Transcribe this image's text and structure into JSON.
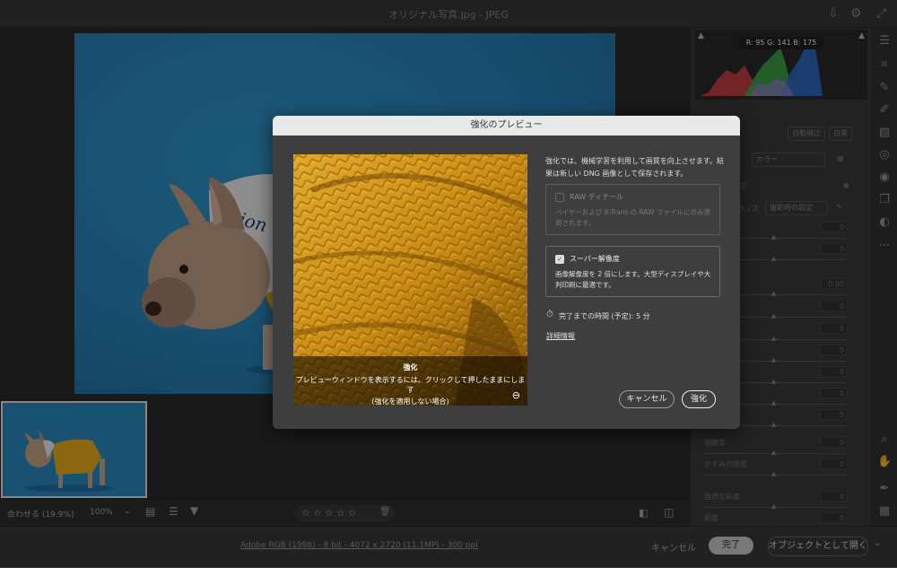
{
  "window": {
    "title": "オリジナル写真.jpg  -  JPEG"
  },
  "histogram": {
    "r_label": "R: 95",
    "g_label": "G: 141",
    "b_label": "B: 175"
  },
  "right_panel": {
    "auto_button": "自動補正",
    "bw_button": "白黒",
    "profile_value": "カラー",
    "wb_label": "ランス",
    "wb_value": "撮影時の設定",
    "section_label": "正",
    "sliders": [
      {
        "label": "",
        "value": "0"
      },
      {
        "label": "光",
        "value": "0"
      },
      {
        "label": "",
        "value": "0.00"
      },
      {
        "label": "スト",
        "value": "0"
      },
      {
        "label": "",
        "value": "0"
      },
      {
        "label": "",
        "value": "0"
      },
      {
        "label": "",
        "value": "0"
      },
      {
        "label": "",
        "value": "0"
      },
      {
        "label": "",
        "value": "0"
      },
      {
        "label": "明瞭度",
        "value": "0"
      },
      {
        "label": "かすみの除去",
        "value": "0"
      },
      {
        "label": "自然な彩度",
        "value": "0"
      },
      {
        "label": "彩度",
        "value": "0"
      }
    ]
  },
  "bottom_bar": {
    "fit_label": "合わせる (19.9%)",
    "zoom_label": "100%",
    "stars": [
      "☆",
      "☆",
      "☆",
      "☆",
      "☆"
    ]
  },
  "footer": {
    "info_link": "Adobe RGB (1998) - 8 bit - 4072 x 2720 (11.1MP) - 300 ppi",
    "cancel": "キャンセル",
    "done": "完了",
    "open_object": "オブジェクトとして開く"
  },
  "dialog": {
    "title": "強化のプレビュー",
    "description": "強化では、機械学習を利用して画質を向上させます。結果は新しい DNG 画像として保存されます。",
    "raw_title": "RAW ディテール",
    "raw_desc": "ベイヤーおよび X-Trans の RAW ファイルにのみ適用されます。",
    "sr_title": "スーパー解像度",
    "sr_desc": "画像解像度を 2 倍にします。大型ディスプレイや大判印刷に最適です。",
    "time": "完了までの時間 (予定): 5 分",
    "more_link": "詳細情報",
    "caption_title": "強化",
    "caption_line1": "プレビューウィンドウを表示するには、クリックして押したままにします",
    "caption_line2": "(強化を適用しない場合)",
    "cancel_button": "キャンセル",
    "enhance_button": "強化"
  },
  "colors": {
    "accent": "#2a86bd",
    "dialog_bg": "#3e3e3e",
    "preview_yellow": "#d9a21d"
  }
}
